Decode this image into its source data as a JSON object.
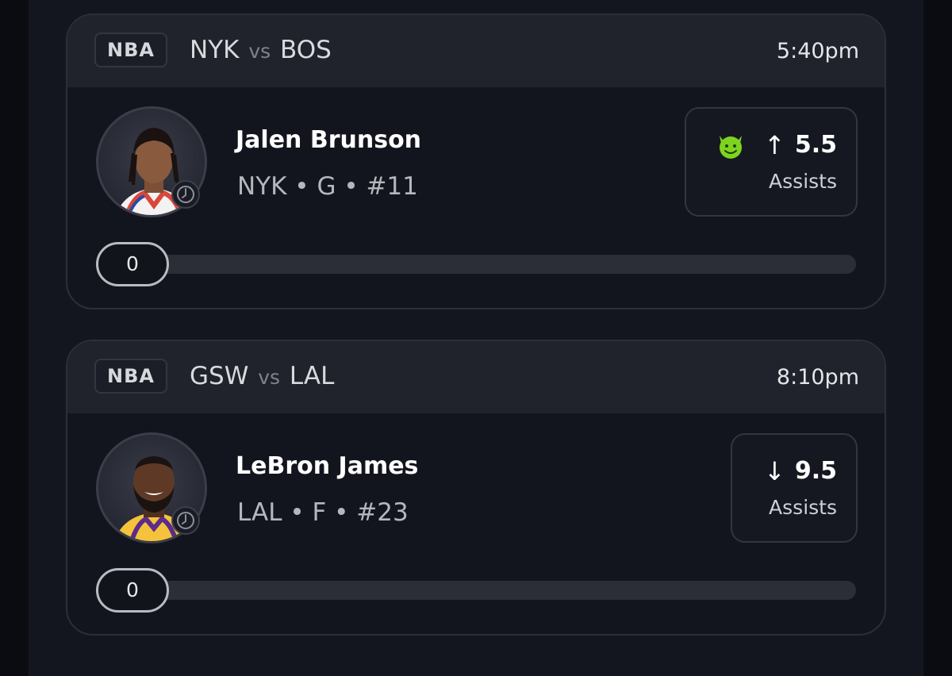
{
  "games": [
    {
      "league": "NBA",
      "team_away": "NYK",
      "vs": "vs",
      "team_home": "BOS",
      "time": "5:40pm",
      "player": {
        "name": "Jalen Brunson",
        "meta": "NYK • G • #11",
        "jersey_color": "#ffffff",
        "skin_color": "#8a5a3f"
      },
      "pick": {
        "has_emoji": true,
        "emoji_icon": "green-devil-icon",
        "direction": "up",
        "arrow": "↑",
        "line": "5.5",
        "stat": "Assists"
      },
      "progress": {
        "current": "0",
        "fraction": 0
      }
    },
    {
      "league": "NBA",
      "team_away": "GSW",
      "vs": "vs",
      "team_home": "LAL",
      "time": "8:10pm",
      "player": {
        "name": "LeBron James",
        "meta": "LAL • F • #23",
        "jersey_color": "#f5c33b",
        "skin_color": "#5e3a26"
      },
      "pick": {
        "has_emoji": false,
        "direction": "down",
        "arrow": "↓",
        "line": "9.5",
        "stat": "Assists"
      },
      "progress": {
        "current": "0",
        "fraction": 0
      }
    }
  ],
  "colors": {
    "accent_green": "#7ed321",
    "background": "#0b0c12",
    "card": "#13151e",
    "header": "#20222c"
  }
}
